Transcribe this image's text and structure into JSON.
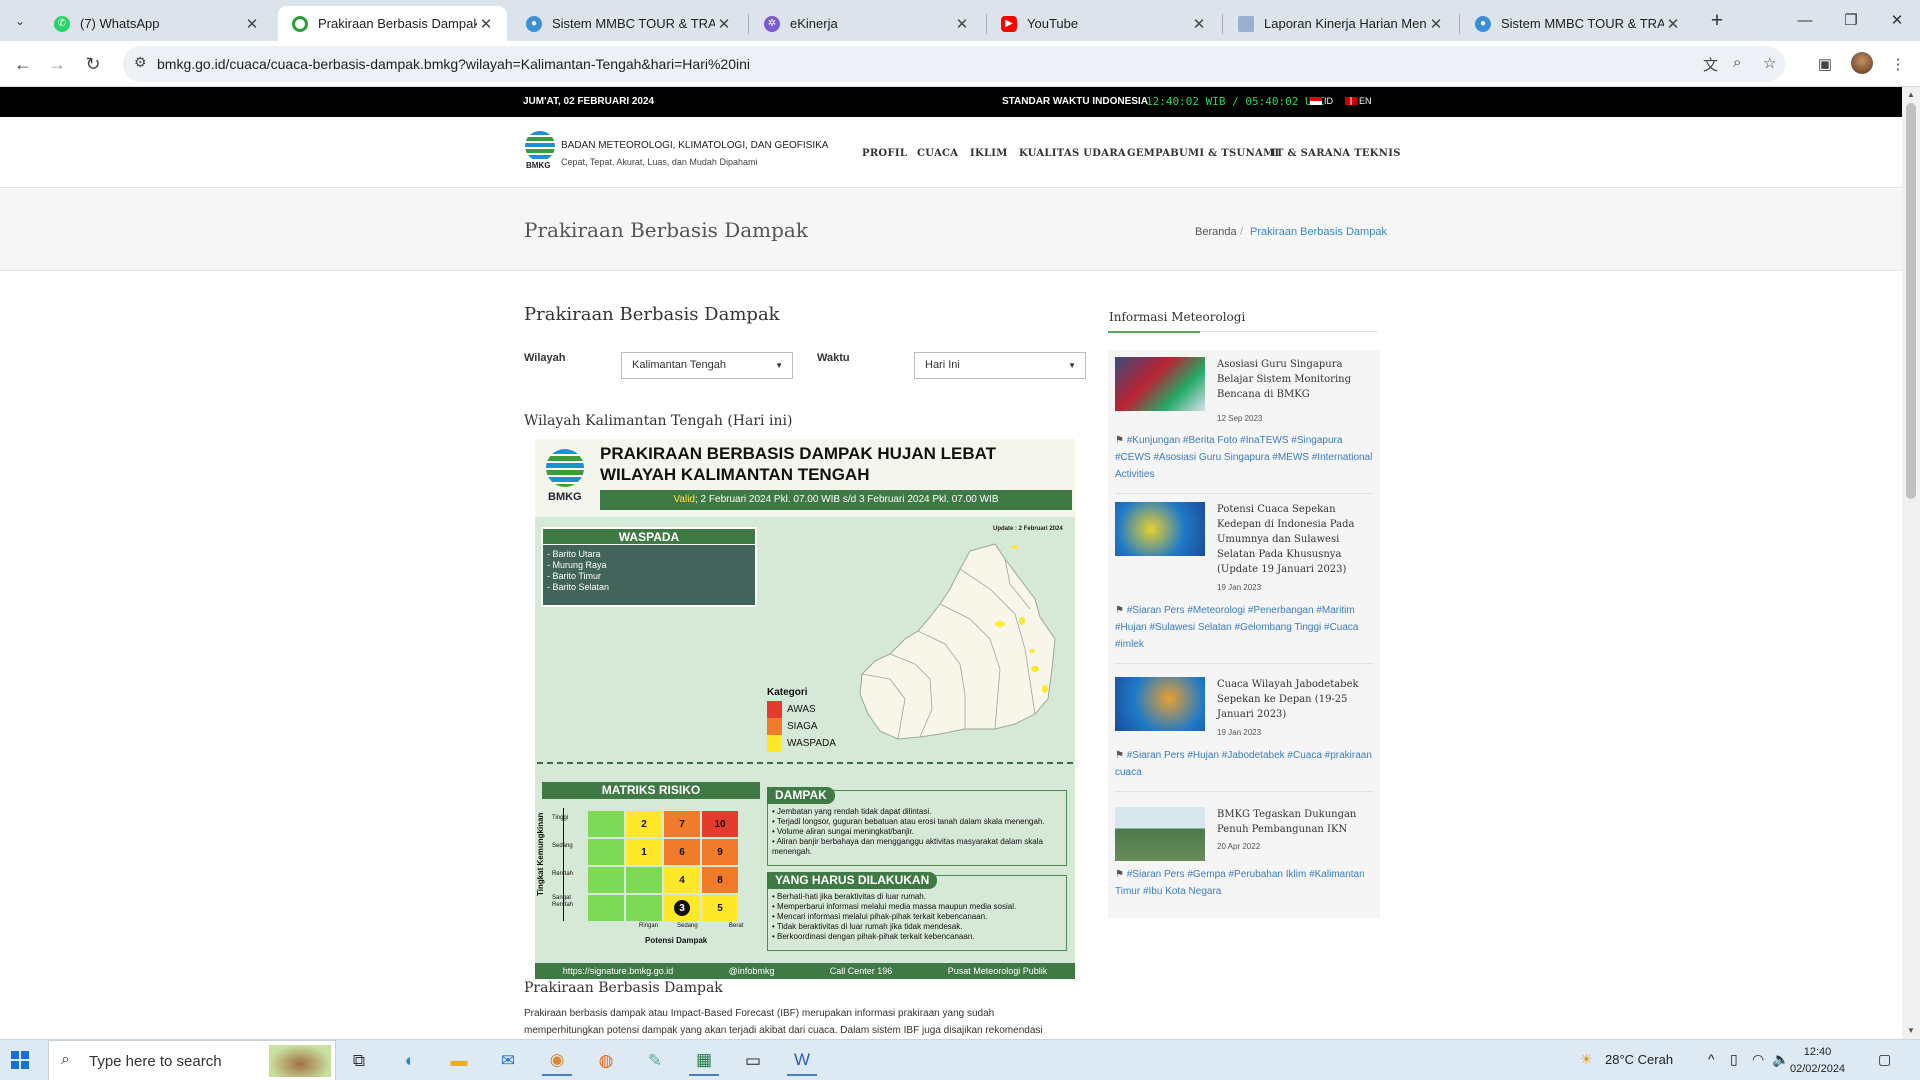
{
  "browser": {
    "tabs": [
      {
        "title": "(7) WhatsApp",
        "icon": "whatsapp-icon",
        "color": "#25d366",
        "active": false
      },
      {
        "title": "Prakiraan Berbasis Dampak Wilayah Kalimantan Tengah",
        "icon": "bmkg-icon",
        "color": "#2a9d3a",
        "active": true
      },
      {
        "title": "Sistem MMBC TOUR & TRAVEL",
        "icon": "globe-icon",
        "color": "#3a8fd8",
        "active": false
      },
      {
        "title": "eKinerja",
        "icon": "ekinerja-icon",
        "color": "#7a5bd0",
        "active": false
      },
      {
        "title": "YouTube",
        "icon": "youtube-icon",
        "color": "#ff0000",
        "active": false
      },
      {
        "title": "Laporan Kinerja Harian Menunggu",
        "icon": "document-icon",
        "color": "#9ab0d0",
        "active": false
      },
      {
        "title": "Sistem MMBC TOUR & TRAVEL",
        "icon": "globe-icon",
        "color": "#3a8fd8",
        "active": false
      }
    ],
    "url": "bmkg.go.id/cuaca/cuaca-berbasis-dampak.bmkg?wilayah=Kalimantan-Tengah&hari=Hari%20ini"
  },
  "topbar": {
    "date": "JUM'AT, 02 FEBRUARI 2024",
    "standard_label": "STANDAR WAKTU INDONESIA",
    "clock": "12:40:02 WIB / 05:40:02 UTC",
    "lang_id": "ID",
    "lang_en": "EN"
  },
  "header": {
    "logo_text": "BMKG",
    "agency": "BADAN METEOROLOGI, KLIMATOLOGI, DAN GEOFISIKA",
    "tagline": "Cepat, Tepat, Akurat, Luas, dan Mudah Dipahami",
    "nav": [
      "PROFIL",
      "CUACA",
      "IKLIM",
      "KUALITAS UDARA",
      "GEMPABUMI & TSUNAMI",
      "IT & SARANA TEKNIS"
    ]
  },
  "titlebar": {
    "title": "Prakiraan Berbasis Dampak",
    "crumb_home": "Beranda",
    "crumb_sep": "/",
    "crumb_current": "Prakiraan Berbasis Dampak"
  },
  "main": {
    "heading": "Prakiraan Berbasis Dampak",
    "wilayah_label": "Wilayah",
    "wilayah_value": "Kalimantan Tengah",
    "waktu_label": "Waktu",
    "waktu_value": "Hari Ini",
    "region_title": "Wilayah Kalimantan Tengah (Hari ini)",
    "ibf_heading": "Prakiraan Berbasis Dampak",
    "description": "Prakiraan berbasis dampak atau Impact-Based Forecast (IBF) merupakan informasi prakiraan yang sudah memperhitungkan potensi dampak yang akan terjadi akibat dari cuaca. Dalam sistem IBF juga disajikan rekomendasi"
  },
  "ibf": {
    "logo_text": "BMKG",
    "title_line1": "PRAKIRAAN BERBASIS DAMPAK HUJAN LEBAT",
    "title_line2": "WILAYAH KALIMANTAN TENGAH",
    "valid_word": "Valid",
    "valid_text": "; 2 Februari 2024 Pkl. 07.00 WIB s/d 3 Februari 2024 Pkl. 07.00 WIB",
    "update": "Update : 2 Februari 2024",
    "waspada_title": "WASPADA",
    "waspada_list": [
      "- Barito Utara",
      "- Murung Raya",
      "- Barito Timur",
      "- Barito Selatan"
    ],
    "kategori_title": "Kategori",
    "kategori": [
      {
        "label": "AWAS",
        "color": "#e53b2c"
      },
      {
        "label": "SIAGA",
        "color": "#f07b2a"
      },
      {
        "label": "WASPADA",
        "color": "#ffe82a"
      }
    ],
    "matrix_title": "MATRIKS RISIKO",
    "matrix_axis_y": "Tingkat Kemungkinan",
    "matrix_rows": [
      "Tinggi",
      "Sedang",
      "Rendah",
      "Sangat Rendah"
    ],
    "matrix_cols": [
      "Ringan",
      "Sedang",
      "Berat"
    ],
    "matrix_axis_x": "Potensi Dampak",
    "matrix_cells": [
      [
        "",
        "2",
        "7",
        "10"
      ],
      [
        "",
        "1",
        "6",
        "9"
      ],
      [
        "",
        "",
        "4",
        "8"
      ],
      [
        "",
        "",
        "3",
        "5"
      ]
    ],
    "dampak_title": "DAMPAK",
    "dampak_list": [
      "• Jembatan yang rendah tidak dapat dilintasi.",
      "• Terjadi longsor, guguran bebatuan atau erosi tanah dalam skala menengah.",
      "• Volume aliran sungai meningkat/banjir.",
      "• Aliran banjir berbahaya dan mengganggu aktivitas masyarakat dalam skala menengah."
    ],
    "action_title": "YANG HARUS DILAKUKAN",
    "action_list": [
      "• Berhati-hati jika beraktivitas di luar rumah.",
      "• Memperbarui informasi melalui media massa maupun media sosial.",
      "• Mencari informasi melalui pihak-pihak terkait kebencanaan.",
      "• Tidak beraktivitas di luar rumah jika tidak mendesak.",
      "• Berkoordinasi dengan pihak-pihak terkait kebencanaan."
    ],
    "footer": [
      "https://signature.bmkg.go.id",
      "@infobmkg",
      "Call Center 196",
      "Pusat Meteorologi Publik"
    ]
  },
  "sidebar": {
    "title": "Informasi Meteorologi",
    "articles": [
      {
        "title": "Asosiasi Guru Singapura Belajar Sistem Monitoring Bencana di BMKG",
        "date": "12 Sep 2023",
        "tags": "#Kunjungan #Berita Foto #InaTEWS #Singapura #CEWS #Asosiasi Guru Singapura #MEWS #International Activities"
      },
      {
        "title": "Potensi Cuaca Sepekan Kedepan di Indonesia Pada Umumnya dan Sulawesi Selatan Pada Khususnya (Update 19 Januari 2023)",
        "date": "19 Jan 2023",
        "tags": "#Siaran Pers #Meteorologi #Penerbangan #Maritim #Hujan #Sulawesi Selatan #Gelombang Tinggi #Cuaca #imlek"
      },
      {
        "title": "Cuaca Wilayah Jabodetabek Sepekan ke Depan (19-25 Januari 2023)",
        "date": "19 Jan 2023",
        "tags": "#Siaran Pers #Hujan #Jabodetabek #Cuaca #prakiraan cuaca"
      },
      {
        "title": "BMKG Tegaskan Dukungan Penuh Pembangunan IKN",
        "date": "20 Apr 2022",
        "tags": "#Siaran Pers #Gempa #Perubahan Iklim #Kalimantan Timur #Ibu Kota Negara"
      }
    ]
  },
  "taskbar": {
    "search_placeholder": "Type here to search",
    "weather": "28°C  Cerah",
    "time": "12:40",
    "date": "02/02/2024"
  }
}
